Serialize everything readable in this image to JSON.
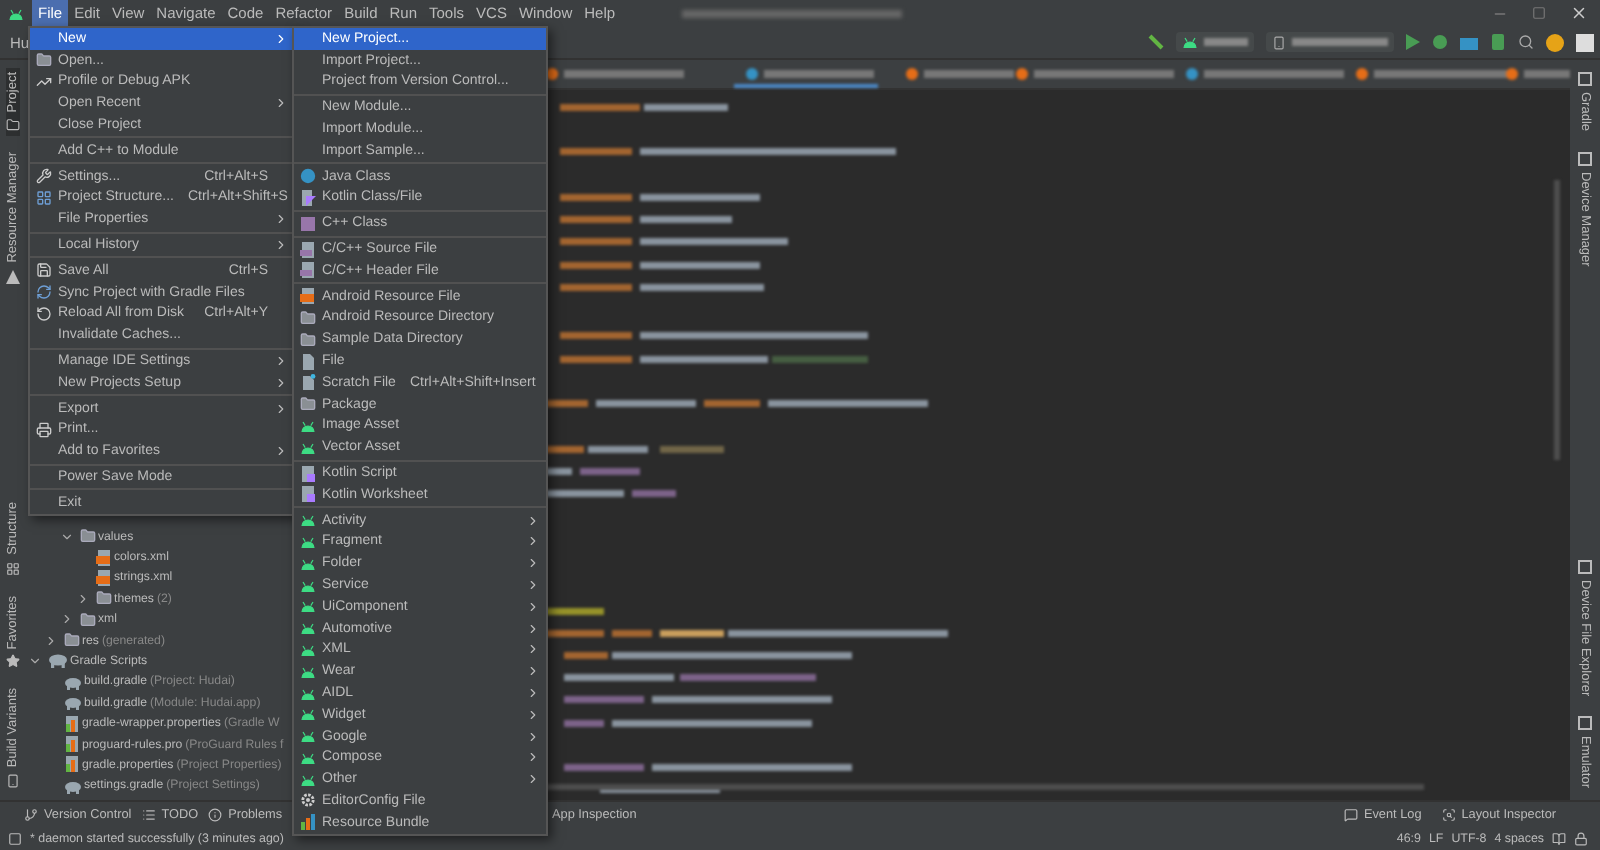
{
  "menu_bar": [
    {
      "label": "File",
      "selected": true
    },
    {
      "label": "Edit",
      "selected": false
    },
    {
      "label": "View",
      "selected": false
    },
    {
      "label": "Navigate",
      "selected": false
    },
    {
      "label": "Code",
      "selected": false
    },
    {
      "label": "Refactor",
      "selected": false
    },
    {
      "label": "Build",
      "selected": false
    },
    {
      "label": "Run",
      "selected": false
    },
    {
      "label": "Tools",
      "selected": false
    },
    {
      "label": "VCS",
      "selected": false
    },
    {
      "label": "Window",
      "selected": false
    },
    {
      "label": "Help",
      "selected": false
    }
  ],
  "breadcrumb": "Hu",
  "left_stripe_top": [
    {
      "label": "Project",
      "selected": true
    },
    {
      "label": "Resource Manager",
      "selected": false
    }
  ],
  "left_stripe_bottom": [
    {
      "label": "Structure",
      "selected": false
    },
    {
      "label": "Favorites",
      "selected": false
    },
    {
      "label": "Build Variants",
      "selected": false
    }
  ],
  "right_stripe_top": [
    "Gradle",
    "Device Manager"
  ],
  "right_stripe_bottom": [
    "Device File Explorer",
    "Emulator"
  ],
  "project_tree": [
    {
      "children": [
        {
          "children": [
            {
              "label": "values",
              "kind": "folder",
              "expanded": true,
              "children": [
                {
                  "label": "colors.xml",
                  "kind": "xml_file"
                },
                {
                  "label": "strings.xml",
                  "kind": "xml_file"
                },
                {
                  "label": "themes",
                  "note": "(2)",
                  "kind": "folder",
                  "expanded": false
                }
              ]
            },
            {
              "label": "xml",
              "kind": "folder",
              "expanded": false
            }
          ]
        },
        {
          "label": "res",
          "note": "(generated)",
          "kind": "folder",
          "expanded": false
        }
      ]
    },
    {
      "label": "Gradle Scripts",
      "kind": "scripts_group",
      "expanded": true,
      "children": [
        {
          "label": "build.gradle",
          "note": "(Project: Hudai)",
          "kind": "gradle_file"
        },
        {
          "label": "build.gradle",
          "note": "(Module: Hudai.app)",
          "kind": "gradle_file"
        },
        {
          "label": "gradle-wrapper.properties",
          "note": "(Gradle W",
          "kind": "properties_file"
        },
        {
          "label": "proguard-rules.pro",
          "note": "(ProGuard Rules f",
          "kind": "properties_file"
        },
        {
          "label": "gradle.properties",
          "note": "(Project Properties)",
          "kind": "properties_file"
        },
        {
          "label": "settings.gradle",
          "note": "(Project Settings)",
          "kind": "gradle_file"
        }
      ]
    }
  ],
  "file_menu": {
    "groups": [
      [
        {
          "label": "New",
          "selected": true,
          "submenu": true
        },
        {
          "label": "Open...",
          "selected": false
        },
        {
          "label": "Profile or Debug APK",
          "selected": false
        },
        {
          "label": "Open Recent",
          "selected": false,
          "submenu": true
        },
        {
          "label": "Close Project",
          "selected": false
        }
      ],
      [
        {
          "label": "Add C++ to Module",
          "selected": false
        }
      ],
      [
        {
          "label": "Settings...",
          "shortcut": "Ctrl+Alt+S",
          "selected": false
        },
        {
          "label": "Project Structure...",
          "shortcut": "Ctrl+Alt+Shift+S",
          "selected": false
        },
        {
          "label": "File Properties",
          "selected": false,
          "submenu": true
        }
      ],
      [
        {
          "label": "Local History",
          "selected": false,
          "submenu": true
        }
      ],
      [
        {
          "label": "Save All",
          "shortcut": "Ctrl+S",
          "selected": false
        },
        {
          "label": "Sync Project with Gradle Files",
          "selected": false
        },
        {
          "label": "Reload All from Disk",
          "shortcut": "Ctrl+Alt+Y",
          "selected": false
        },
        {
          "label": "Invalidate Caches...",
          "selected": false
        }
      ],
      [
        {
          "label": "Manage IDE Settings",
          "selected": false,
          "submenu": true
        },
        {
          "label": "New Projects Setup",
          "selected": false,
          "submenu": true
        }
      ],
      [
        {
          "label": "Export",
          "selected": false,
          "submenu": true
        },
        {
          "label": "Print...",
          "selected": false
        },
        {
          "label": "Add to Favorites",
          "selected": false,
          "submenu": true
        }
      ],
      [
        {
          "label": "Power Save Mode",
          "selected": false
        }
      ],
      [
        {
          "label": "Exit",
          "selected": false
        }
      ]
    ]
  },
  "new_submenu": {
    "groups": [
      [
        {
          "label": "New Project...",
          "selected": true
        },
        {
          "label": "Import Project...",
          "selected": false
        },
        {
          "label": "Project from Version Control...",
          "selected": false
        }
      ],
      [
        {
          "label": "New Module...",
          "selected": false
        },
        {
          "label": "Import Module...",
          "selected": false
        },
        {
          "label": "Import Sample...",
          "selected": false
        }
      ],
      [
        {
          "label": "Java Class",
          "selected": false
        },
        {
          "label": "Kotlin Class/File",
          "selected": false
        }
      ],
      [
        {
          "label": "C++ Class",
          "selected": false
        }
      ],
      [
        {
          "label": "C/C++ Source File",
          "selected": false
        },
        {
          "label": "C/C++ Header File",
          "selected": false
        }
      ],
      [
        {
          "label": "Android Resource File",
          "selected": false
        },
        {
          "label": "Android Resource Directory",
          "selected": false
        },
        {
          "label": "Sample Data Directory",
          "selected": false
        },
        {
          "label": "File",
          "selected": false
        },
        {
          "label": "Scratch File",
          "shortcut": "Ctrl+Alt+Shift+Insert",
          "selected": false
        },
        {
          "label": "Package",
          "selected": false
        },
        {
          "label": "Image Asset",
          "selected": false
        },
        {
          "label": "Vector Asset",
          "selected": false
        }
      ],
      [
        {
          "label": "Kotlin Script",
          "selected": false
        },
        {
          "label": "Kotlin Worksheet",
          "selected": false
        }
      ],
      [
        {
          "label": "Activity",
          "selected": false,
          "submenu": true
        },
        {
          "label": "Fragment",
          "selected": false,
          "submenu": true
        },
        {
          "label": "Folder",
          "selected": false,
          "submenu": true
        },
        {
          "label": "Service",
          "selected": false,
          "submenu": true
        },
        {
          "label": "UiComponent",
          "selected": false,
          "submenu": true
        },
        {
          "label": "Automotive",
          "selected": false,
          "submenu": true
        },
        {
          "label": "XML",
          "selected": false,
          "submenu": true
        },
        {
          "label": "Wear",
          "selected": false,
          "submenu": true
        },
        {
          "label": "AIDL",
          "selected": false,
          "submenu": true
        },
        {
          "label": "Widget",
          "selected": false,
          "submenu": true
        },
        {
          "label": "Google",
          "selected": false,
          "submenu": true
        },
        {
          "label": "Compose",
          "selected": false,
          "submenu": true
        },
        {
          "label": "Other",
          "selected": false,
          "submenu": true
        },
        {
          "label": "EditorConfig File",
          "selected": false
        },
        {
          "label": "Resource Bundle",
          "selected": false
        }
      ]
    ]
  },
  "bottom_tools": {
    "left": [
      "Version Control",
      "TODO",
      "Problems"
    ],
    "middle": [
      "App Inspection"
    ],
    "right": [
      "Event Log",
      "Layout Inspector"
    ]
  },
  "status_bar": {
    "message": "* daemon started successfully (3 minutes ago)",
    "indicators": [
      "46:9",
      "LF",
      "UTF-8",
      "4 spaces"
    ]
  }
}
